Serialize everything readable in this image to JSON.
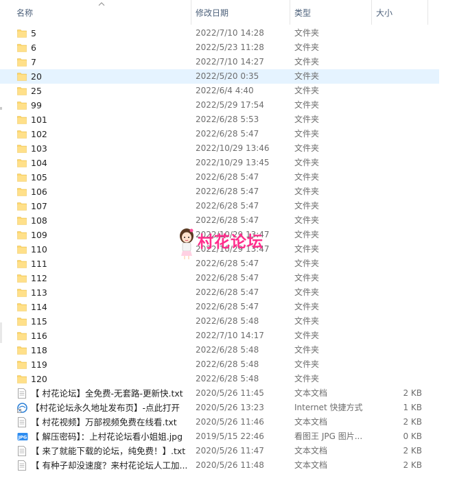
{
  "columns": {
    "name": "名称",
    "date": "修改日期",
    "type": "类型",
    "size": "大小"
  },
  "sort": {
    "column": "name",
    "direction": "ascending",
    "indicator": "^"
  },
  "items": [
    {
      "name": "5",
      "date": "2022/7/10 14:28",
      "type": "文件夹",
      "size": "",
      "icon": "folder-icon"
    },
    {
      "name": "6",
      "date": "2022/5/23 11:28",
      "type": "文件夹",
      "size": "",
      "icon": "folder-icon"
    },
    {
      "name": "7",
      "date": "2022/7/10 14:27",
      "type": "文件夹",
      "size": "",
      "icon": "folder-icon"
    },
    {
      "name": "20",
      "date": "2022/5/20 0:35",
      "type": "文件夹",
      "size": "",
      "icon": "folder-icon",
      "selected": true
    },
    {
      "name": "25",
      "date": "2022/6/4 4:40",
      "type": "文件夹",
      "size": "",
      "icon": "folder-icon"
    },
    {
      "name": "99",
      "date": "2022/5/29 17:54",
      "type": "文件夹",
      "size": "",
      "icon": "folder-icon"
    },
    {
      "name": "101",
      "date": "2022/6/28 5:53",
      "type": "文件夹",
      "size": "",
      "icon": "folder-icon"
    },
    {
      "name": "102",
      "date": "2022/6/28 5:47",
      "type": "文件夹",
      "size": "",
      "icon": "folder-icon"
    },
    {
      "name": "103",
      "date": "2022/10/29 13:46",
      "type": "文件夹",
      "size": "",
      "icon": "folder-icon"
    },
    {
      "name": "104",
      "date": "2022/10/29 13:45",
      "type": "文件夹",
      "size": "",
      "icon": "folder-icon"
    },
    {
      "name": "105",
      "date": "2022/6/28 5:47",
      "type": "文件夹",
      "size": "",
      "icon": "folder-icon"
    },
    {
      "name": "106",
      "date": "2022/6/28 5:47",
      "type": "文件夹",
      "size": "",
      "icon": "folder-icon"
    },
    {
      "name": "107",
      "date": "2022/6/28 5:47",
      "type": "文件夹",
      "size": "",
      "icon": "folder-icon"
    },
    {
      "name": "108",
      "date": "2022/6/28 5:47",
      "type": "文件夹",
      "size": "",
      "icon": "folder-icon"
    },
    {
      "name": "109",
      "date": "2022/10/29 13:47",
      "type": "文件夹",
      "size": "",
      "icon": "folder-icon"
    },
    {
      "name": "110",
      "date": "2022/10/29 13:47",
      "type": "文件夹",
      "size": "",
      "icon": "folder-icon"
    },
    {
      "name": "111",
      "date": "2022/6/28 5:47",
      "type": "文件夹",
      "size": "",
      "icon": "folder-icon"
    },
    {
      "name": "112",
      "date": "2022/6/28 5:47",
      "type": "文件夹",
      "size": "",
      "icon": "folder-icon"
    },
    {
      "name": "113",
      "date": "2022/6/28 5:47",
      "type": "文件夹",
      "size": "",
      "icon": "folder-icon"
    },
    {
      "name": "114",
      "date": "2022/6/28 5:47",
      "type": "文件夹",
      "size": "",
      "icon": "folder-icon"
    },
    {
      "name": "115",
      "date": "2022/6/28 5:48",
      "type": "文件夹",
      "size": "",
      "icon": "folder-icon"
    },
    {
      "name": "116",
      "date": "2022/7/10 14:17",
      "type": "文件夹",
      "size": "",
      "icon": "folder-icon"
    },
    {
      "name": "118",
      "date": "2022/6/28 5:48",
      "type": "文件夹",
      "size": "",
      "icon": "folder-icon"
    },
    {
      "name": "119",
      "date": "2022/6/28 5:48",
      "type": "文件夹",
      "size": "",
      "icon": "folder-icon"
    },
    {
      "name": "120",
      "date": "2022/6/28 5:48",
      "type": "文件夹",
      "size": "",
      "icon": "folder-icon"
    },
    {
      "name": "【 村花论坛】全免费-无套路-更新快.txt",
      "date": "2020/5/26 11:45",
      "type": "文本文档",
      "size": "2 KB",
      "icon": "text-file-icon"
    },
    {
      "name": "【村花论坛永久地址发布页】-点此打开",
      "date": "2020/5/26 13:23",
      "type": "Internet 快捷方式",
      "size": "1 KB",
      "icon": "internet-shortcut-icon"
    },
    {
      "name": "【 村花视频】万部视频免费在线看.txt",
      "date": "2020/5/26 11:46",
      "type": "文本文档",
      "size": "2 KB",
      "icon": "text-file-icon"
    },
    {
      "name": "【 解压密码】：上村花论坛看小姐姐.jpg",
      "date": "2019/5/15 22:46",
      "type": "看图王 JPG 图片...",
      "size": "0 KB",
      "icon": "jpg-file-icon"
    },
    {
      "name": "【 来了就能下载的论坛，纯免费！】.txt",
      "date": "2020/5/26 11:47",
      "type": "文本文档",
      "size": "2 KB",
      "icon": "text-file-icon"
    },
    {
      "name": "【 有种子却没速度？来村花论坛人工加...",
      "date": "2020/5/26 11:48",
      "type": "文本文档",
      "size": "2 KB",
      "icon": "text-file-icon"
    }
  ],
  "watermark": {
    "text": "村花论坛",
    "icon": "cartoon-girl-icon",
    "color": "#ff2e8c"
  },
  "colors": {
    "selection": "#e5f3ff",
    "folder": "#ffd86e",
    "header_text": "#4c607a",
    "secondary_text": "#6d6d6d"
  }
}
